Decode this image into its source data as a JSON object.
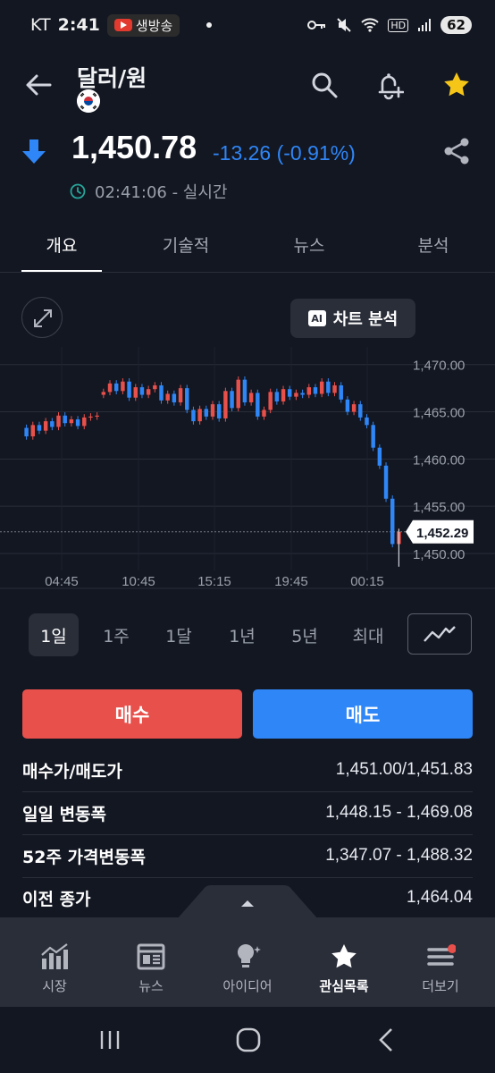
{
  "status_bar": {
    "carrier": "KT",
    "time": "2:41",
    "live_chip": "생방송",
    "network": "HD",
    "battery": "62"
  },
  "header": {
    "title": "달러/원",
    "icons": [
      "back-arrow-icon",
      "search-icon",
      "add-alert-icon",
      "star-icon"
    ]
  },
  "quote": {
    "price": "1,450.78",
    "change": "-13.26 (-0.91%)",
    "timestamp": "02:41:06 - 실시간",
    "direction": "down",
    "accent_down": "#2f86f6",
    "accent_up": "#e8504b"
  },
  "tabs": [
    {
      "label": "개요",
      "active": true
    },
    {
      "label": "기술적",
      "active": false
    },
    {
      "label": "뉴스",
      "active": false
    },
    {
      "label": "분석",
      "active": false
    }
  ],
  "chart_toolbar": {
    "ai_badge": "AI",
    "ai_label": "차트 분석"
  },
  "chart_data": {
    "type": "candlestick",
    "y_ticks": [
      "1,470.00",
      "1,465.00",
      "1,460.00",
      "1,455.00",
      "1,450.00"
    ],
    "ylim": [
      1448.2,
      1471.3
    ],
    "x_ticks": [
      "04:45",
      "10:45",
      "15:15",
      "19:45",
      "00:15"
    ],
    "last_price_label": "1,452.29",
    "last_price": 1452.29,
    "grid": true,
    "candles": [
      [
        1463.3,
        1462.4
      ],
      [
        1462.4,
        1463.6
      ],
      [
        1463.6,
        1463.0
      ],
      [
        1463.0,
        1464.0
      ],
      [
        1464.0,
        1463.4
      ],
      [
        1463.4,
        1464.6
      ],
      [
        1464.6,
        1463.8
      ],
      [
        1463.8,
        1464.2
      ],
      [
        1464.2,
        1463.5
      ],
      [
        1463.5,
        1464.4
      ],
      [
        1464.4,
        1464.5
      ],
      [
        1464.5,
        1464.6
      ],
      [
        1466.8,
        1467.1
      ],
      [
        1467.1,
        1468.0
      ],
      [
        1468.0,
        1467.2
      ],
      [
        1467.2,
        1468.2
      ],
      [
        1468.2,
        1466.5
      ],
      [
        1466.5,
        1467.6
      ],
      [
        1467.6,
        1466.8
      ],
      [
        1466.8,
        1467.4
      ],
      [
        1467.4,
        1467.8
      ],
      [
        1467.8,
        1466.2
      ],
      [
        1466.2,
        1466.9
      ],
      [
        1466.9,
        1466.0
      ],
      [
        1466.0,
        1467.5
      ],
      [
        1467.5,
        1465.2
      ],
      [
        1465.2,
        1464.0
      ],
      [
        1464.0,
        1465.3
      ],
      [
        1465.3,
        1464.5
      ],
      [
        1464.5,
        1465.8
      ],
      [
        1465.8,
        1464.3
      ],
      [
        1464.3,
        1467.2
      ],
      [
        1467.2,
        1465.4
      ],
      [
        1465.4,
        1468.4
      ],
      [
        1468.4,
        1466.0
      ],
      [
        1466.0,
        1467.0
      ],
      [
        1467.0,
        1464.5
      ],
      [
        1464.5,
        1465.2
      ],
      [
        1465.2,
        1467.1
      ],
      [
        1467.1,
        1466.1
      ],
      [
        1466.1,
        1467.4
      ],
      [
        1467.4,
        1466.6
      ],
      [
        1466.6,
        1467.0
      ],
      [
        1467.0,
        1466.8
      ],
      [
        1466.8,
        1467.6
      ],
      [
        1467.6,
        1466.9
      ],
      [
        1466.9,
        1468.2
      ],
      [
        1468.2,
        1467.0
      ],
      [
        1467.0,
        1467.8
      ],
      [
        1467.8,
        1466.3
      ],
      [
        1466.3,
        1465.0
      ],
      [
        1465.0,
        1465.8
      ],
      [
        1465.8,
        1464.4
      ],
      [
        1464.4,
        1463.6
      ],
      [
        1463.6,
        1461.2
      ],
      [
        1461.2,
        1459.3
      ],
      [
        1459.3,
        1455.8
      ],
      [
        1455.8,
        1451.0
      ],
      [
        1451.0,
        1452.29
      ]
    ]
  },
  "periods": [
    {
      "label": "1일",
      "active": true
    },
    {
      "label": "1주",
      "active": false
    },
    {
      "label": "1달",
      "active": false
    },
    {
      "label": "1년",
      "active": false
    },
    {
      "label": "5년",
      "active": false
    },
    {
      "label": "최대",
      "active": false
    }
  ],
  "actions": {
    "buy": "매수",
    "sell": "매도"
  },
  "stats": [
    {
      "label": "매수가/매도가",
      "value": "1,451.00/1,451.83"
    },
    {
      "label": "일일 변동폭",
      "value": "1,448.15 - 1,469.08"
    },
    {
      "label": "52주 가격변동폭",
      "value": "1,347.07 - 1,488.32"
    },
    {
      "label": "이전 종가",
      "value": "1,464.04"
    }
  ],
  "bottom_nav": [
    {
      "label": "시장",
      "icon": "market-chart-icon",
      "active": false
    },
    {
      "label": "뉴스",
      "icon": "news-icon",
      "active": false
    },
    {
      "label": "아이디어",
      "icon": "lightbulb-icon",
      "active": false
    },
    {
      "label": "관심목록",
      "icon": "star-icon",
      "active": true
    },
    {
      "label": "더보기",
      "icon": "menu-icon",
      "active": false
    }
  ]
}
